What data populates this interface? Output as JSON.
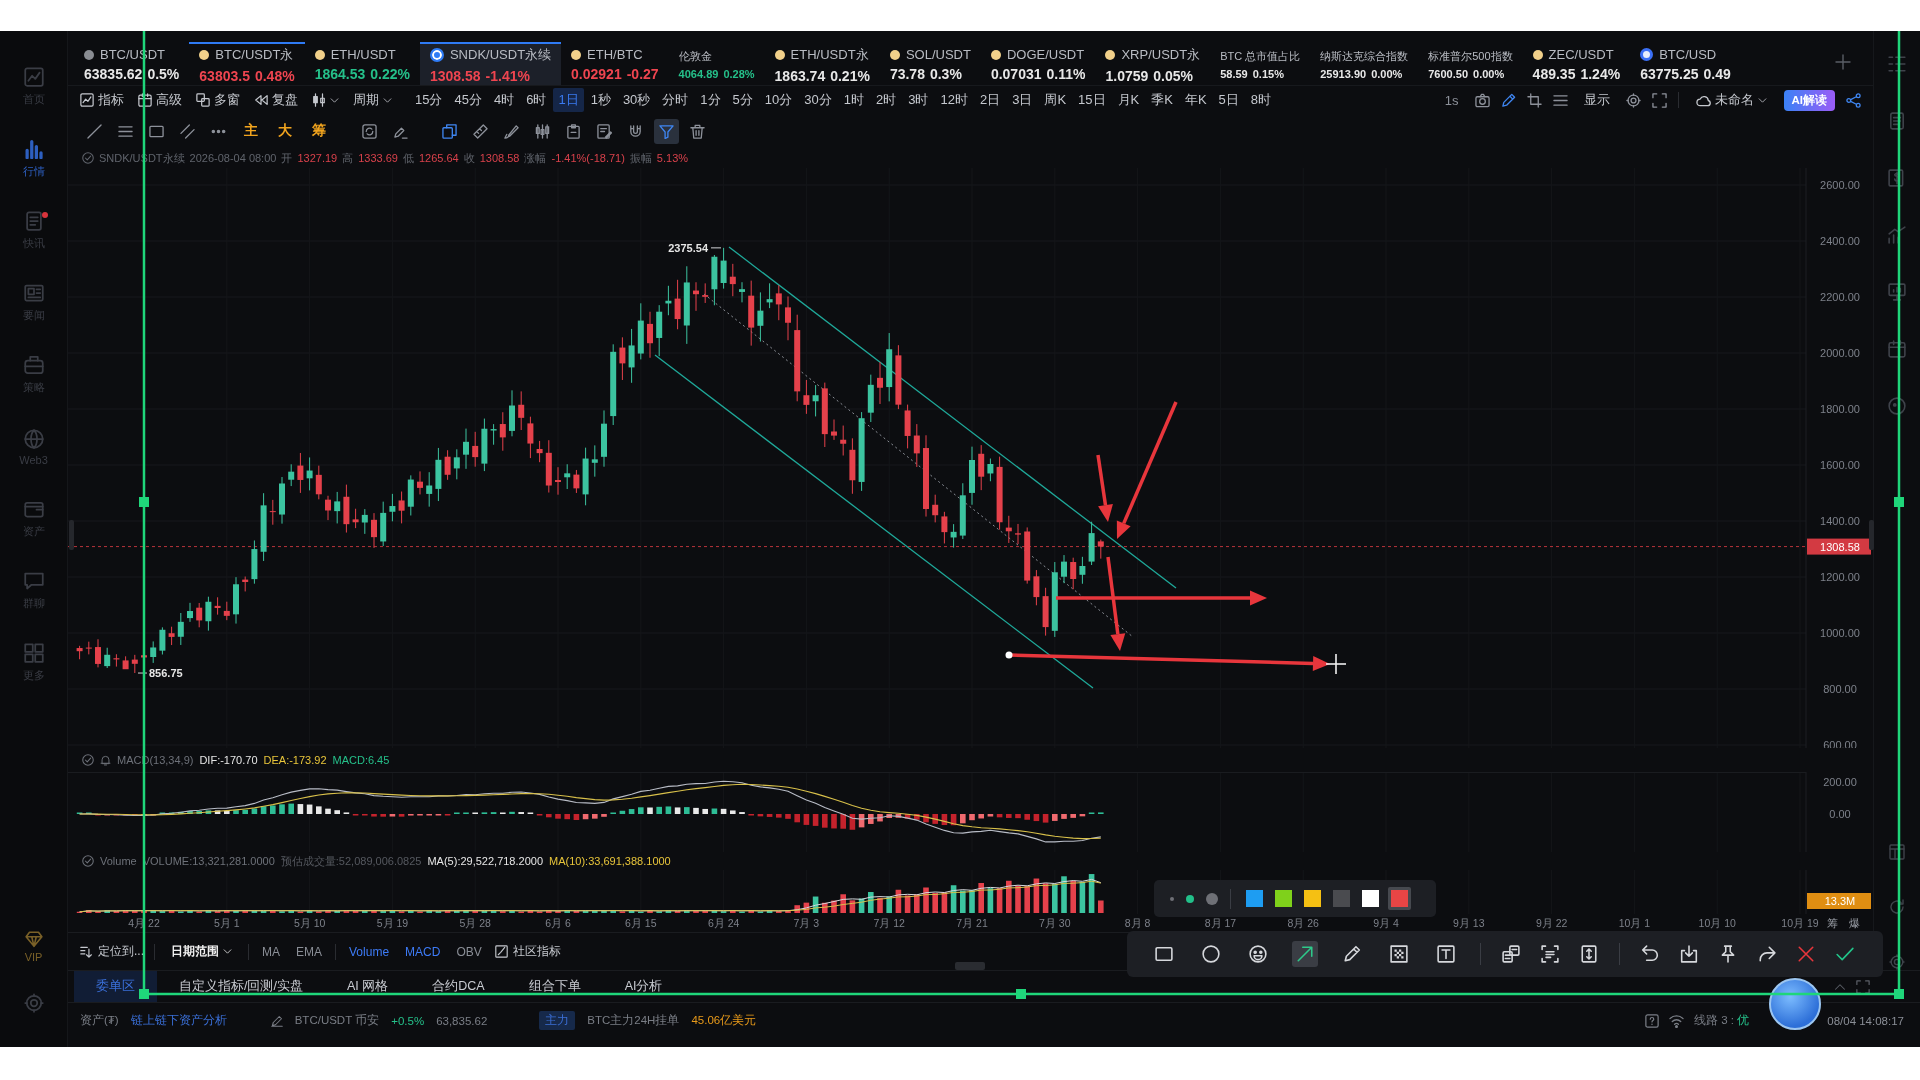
{
  "sidebar": {
    "items": [
      {
        "label": "首页",
        "selected": false,
        "unread": false
      },
      {
        "label": "行情",
        "selected": true,
        "unread": false
      },
      {
        "label": "快讯",
        "selected": false,
        "unread": true
      },
      {
        "label": "要闻",
        "selected": false,
        "unread": false
      },
      {
        "label": "策略",
        "selected": false,
        "unread": false
      },
      {
        "label": "Web3",
        "selected": false,
        "unread": false
      },
      {
        "label": "资产",
        "selected": false,
        "unread": false
      },
      {
        "label": "群聊",
        "selected": false,
        "unread": false
      },
      {
        "label": "更多",
        "selected": false,
        "unread": false
      }
    ],
    "vip": "VIP"
  },
  "tickers": [
    {
      "kind": "coin",
      "color": "#8a8d93",
      "name": "BTC/USDT",
      "quote": {
        "price": "63835.62",
        "change": "0.5%",
        "color": "#e8e8e8"
      },
      "selected": false,
      "outlined": false
    },
    {
      "kind": "coin",
      "color": "#f1d08a",
      "name": "BTC/USDT永",
      "quote": {
        "price": "63803.5",
        "change": "0.48%",
        "color": "#ef4550"
      },
      "selected": false,
      "outlined": true
    },
    {
      "kind": "coin",
      "color": "#f1d08a",
      "name": "ETH/USDT",
      "quote": {
        "price": "1864.53",
        "change": "0.22%",
        "color": "#25c08a"
      },
      "selected": false,
      "outlined": false
    },
    {
      "kind": "logo",
      "color": "#2f7cf6",
      "name": "SNDK/USDT永续",
      "quote": {
        "price": "1308.58",
        "change": "-1.41%",
        "color": "#ef4550"
      },
      "selected": true,
      "outlined": true
    },
    {
      "kind": "coin",
      "color": "#f1d08a",
      "name": "ETH/BTC",
      "quote": {
        "price": "0.02921",
        "change": "-0.27",
        "color": "#ef4550"
      },
      "selected": false,
      "outlined": false
    },
    {
      "kind": "index",
      "name": "伦敦金",
      "quote": {
        "price": "4064.89",
        "change": "0.28%",
        "color": "#25c08a"
      },
      "selected": false,
      "outlined": false
    },
    {
      "kind": "coin",
      "color": "#f1d08a",
      "name": "ETH/USDT永",
      "quote": {
        "price": "1863.74",
        "change": "0.21%",
        "color": "#e8e8e8"
      },
      "selected": false,
      "outlined": false
    },
    {
      "kind": "coin",
      "color": "#f1d08a",
      "name": "SOL/USDT",
      "quote": {
        "price": "73.78",
        "change": "0.3%",
        "color": "#e8e8e8"
      },
      "selected": false,
      "outlined": false
    },
    {
      "kind": "coin",
      "color": "#f1d08a",
      "name": "DOGE/USDT",
      "quote": {
        "price": "0.07031",
        "change": "0.11%",
        "color": "#e8e8e8"
      },
      "selected": false,
      "outlined": false
    },
    {
      "kind": "coin",
      "color": "#f1d08a",
      "name": "XRP/USDT永",
      "quote": {
        "price": "1.0759",
        "change": "0.05%",
        "color": "#e8e8e8"
      },
      "selected": false,
      "outlined": false
    },
    {
      "kind": "index",
      "name": "BTC 总市值占比",
      "quote": {
        "price": "58.59",
        "change": "0.15%",
        "color": "#e8e8e8"
      },
      "selected": false,
      "outlined": false
    },
    {
      "kind": "index",
      "name": "纳斯达克综合指数",
      "quote": {
        "price": "25913.90",
        "change": "0.00%",
        "color": "#e8e8e8"
      },
      "selected": false,
      "outlined": false
    },
    {
      "kind": "index",
      "name": "标准普尔500指数",
      "quote": {
        "price": "7600.50",
        "change": "0.00%",
        "color": "#e8e8e8"
      },
      "selected": false,
      "outlined": false
    },
    {
      "kind": "coin",
      "color": "#f1d08a",
      "name": "ZEC/USDT",
      "quote": {
        "price": "489.35",
        "change": "1.24%",
        "color": "#e8e8e8"
      },
      "selected": false,
      "outlined": false
    },
    {
      "kind": "ring",
      "color": "#3b6ff5",
      "name": "BTC/USD",
      "quote": {
        "price": "63775.25",
        "change": "0.49",
        "color": "#e8e8e8"
      },
      "selected": false,
      "outlined": false
    }
  ],
  "toolbar": {
    "tools": [
      {
        "label": "指标"
      },
      {
        "label": "高级"
      },
      {
        "label": "多窗"
      },
      {
        "label": "复盘"
      }
    ],
    "period_menu": "周期",
    "periods": [
      {
        "label": "15分",
        "selected": false
      },
      {
        "label": "45分",
        "selected": false
      },
      {
        "label": "4时",
        "selected": false
      },
      {
        "label": "6时",
        "selected": false
      },
      {
        "label": "1日",
        "selected": true
      },
      {
        "label": "1秒",
        "selected": false
      },
      {
        "label": "30秒",
        "selected": false
      },
      {
        "label": "分时",
        "selected": false
      },
      {
        "label": "1分",
        "selected": false
      },
      {
        "label": "5分",
        "selected": false
      },
      {
        "label": "10分",
        "selected": false
      },
      {
        "label": "30分",
        "selected": false
      },
      {
        "label": "1时",
        "selected": false
      },
      {
        "label": "2时",
        "selected": false
      },
      {
        "label": "3时",
        "selected": false
      },
      {
        "label": "12时",
        "selected": false
      },
      {
        "label": "2日",
        "selected": false
      },
      {
        "label": "3日",
        "selected": false
      },
      {
        "label": "周K",
        "selected": false
      },
      {
        "label": "15日",
        "selected": false
      },
      {
        "label": "月K",
        "selected": false
      },
      {
        "label": "季K",
        "selected": false
      },
      {
        "label": "年K",
        "selected": false
      },
      {
        "label": "5日",
        "selected": false
      },
      {
        "label": "8时",
        "selected": false
      }
    ],
    "interval": "1s",
    "display": "显示",
    "layout_name": "未命名",
    "ai_button": "AI解读"
  },
  "drawing_tools": [
    {
      "kind": "icon",
      "selected": false
    },
    {
      "kind": "icon",
      "selected": false
    },
    {
      "kind": "icon",
      "selected": false
    },
    {
      "kind": "icon",
      "selected": false
    },
    {
      "kind": "icon",
      "selected": false
    },
    {
      "kind": "text",
      "label": "主",
      "selected": false
    },
    {
      "kind": "text",
      "label": "大",
      "selected": false
    },
    {
      "kind": "text",
      "label": "筹",
      "selected": false
    },
    {
      "kind": "icon",
      "selected": false
    },
    {
      "kind": "icon",
      "selected": false
    },
    {
      "kind": "icon",
      "selected": false
    },
    {
      "kind": "icon",
      "selected": false
    },
    {
      "kind": "icon",
      "selected": false
    },
    {
      "kind": "icon",
      "selected": false
    },
    {
      "kind": "icon",
      "selected": false
    },
    {
      "kind": "icon",
      "selected": false
    },
    {
      "kind": "icon",
      "selected": false
    },
    {
      "kind": "icon",
      "selected": true
    },
    {
      "kind": "icon",
      "selected": false
    }
  ],
  "quote": {
    "symbol": "SNDK/USDT永续",
    "time": "2026-08-04 08:00",
    "fields": [
      {
        "label": "开",
        "value": "1327.19"
      },
      {
        "label": "高",
        "value": "1333.69"
      },
      {
        "label": "低",
        "value": "1265.64"
      },
      {
        "label": "收",
        "value": "1308.58"
      },
      {
        "label": "涨幅",
        "value": "-1.41%(-18.71)"
      },
      {
        "label": "振幅",
        "value": "5.13%"
      }
    ]
  },
  "main_chart": {
    "price_ticks": [
      "2600.00",
      "2400.00",
      "2200.00",
      "2000.00",
      "1800.00",
      "1600.00",
      "1400.00",
      "1200.00",
      "1000.00",
      "800.00",
      "600.00"
    ],
    "high_label": "2375.54",
    "low_label": "856.75",
    "last_price": "1308.58"
  },
  "macd": {
    "name": "MACD(13,34,9)",
    "dif": "DIF:-170.70",
    "dea": "DEA:-173.92",
    "value": "MACD:6.45",
    "ticks": [
      "200.00",
      "0.00"
    ]
  },
  "volume": {
    "name": "Volume",
    "volume": "VOLUME:13,321,281.0000",
    "estimate": "预估成交量:52,089,006.0825",
    "ma5": "MA(5):29,522,718.2000",
    "ma10": "MA(10):33,691,388.1000",
    "last_volume": "13.3M"
  },
  "date_axis": {
    "labels": [
      "4月 22",
      "5月 1",
      "5月 10",
      "5月 19",
      "5月 28",
      "6月 6",
      "6月 15",
      "6月 24",
      "7月 3",
      "7月 12",
      "7月 21",
      "7月 30",
      "8月 8",
      "8月 17",
      "8月 26",
      "9月 4",
      "9月 13",
      "9月 22",
      "10月 1",
      "10月 10",
      "10月 19"
    ],
    "buttons": [
      "筹",
      "爆"
    ]
  },
  "annotation_palette": {
    "sizes": [
      {
        "selected": false
      },
      {
        "selected": true
      },
      {
        "selected": false
      }
    ],
    "colors": [
      {
        "color": "#1e9df2",
        "selected": false
      },
      {
        "color": "#7fd11b",
        "selected": false
      },
      {
        "color": "#f5c013",
        "selected": false
      },
      {
        "color": "#4a4b4f",
        "selected": false
      },
      {
        "color": "#ffffff",
        "selected": false
      },
      {
        "color": "#e84545",
        "selected": true
      }
    ]
  },
  "capture_toolbar": {
    "tools": [
      {
        "selected": false
      },
      {
        "selected": false
      },
      {
        "selected": false
      },
      {
        "selected": true
      },
      {
        "selected": false
      },
      {
        "selected": false
      },
      {
        "selected": false
      }
    ]
  },
  "indicator_bar": {
    "locate": "定位到...",
    "date_range": "日期范围",
    "indicators": [
      {
        "label": "MA",
        "selected": false
      },
      {
        "label": "EMA",
        "selected": false
      },
      {
        "label": "Volume",
        "selected": true
      },
      {
        "label": "MACD",
        "selected": true
      },
      {
        "label": "OBV",
        "selected": false
      }
    ],
    "community": "社区指标"
  },
  "bottom_tabs": [
    {
      "label": "委单区",
      "selected": true
    },
    {
      "label": "自定义指标/回测/实盘",
      "selected": false
    },
    {
      "label": "AI 网格",
      "selected": false
    },
    {
      "label": "合约DCA",
      "selected": false
    },
    {
      "label": "组合下单",
      "selected": false
    },
    {
      "label": "AI分析",
      "selected": false
    }
  ],
  "status_bar": {
    "asset_label": "资产(₮)",
    "asset_link": "链上链下资产分析",
    "pair": "BTC/USDT 币安",
    "change": "+0.5%",
    "price": "63,835.62",
    "badge": "主力",
    "order_label": "BTC主力24H挂单",
    "order_value": "45.06亿美元",
    "line": "线路 3 :",
    "line_quality": "优",
    "clock": "08/04 14:08:17"
  }
}
